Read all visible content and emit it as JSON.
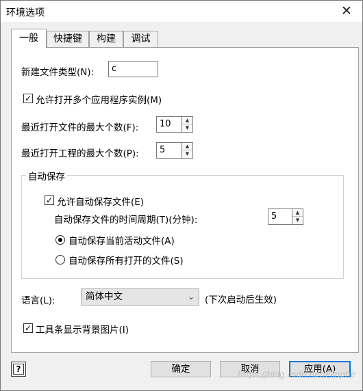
{
  "window": {
    "title": "环境选项",
    "close_glyph": "✕"
  },
  "tabs": [
    {
      "label": "一般",
      "active": true
    },
    {
      "label": "快捷键",
      "active": false
    },
    {
      "label": "构建",
      "active": false
    },
    {
      "label": "调试",
      "active": false
    }
  ],
  "general": {
    "new_file_type_label": "新建文件类型(N):",
    "new_file_type_value": "c",
    "allow_multi_instance_label": "允许打开多个应用程序实例(M)",
    "allow_multi_instance_checked": true,
    "recent_files_label": "最近打开文件的最大个数(F):",
    "recent_files_value": "10",
    "recent_projects_label": "最近打开工程的最大个数(P):",
    "recent_projects_value": "5"
  },
  "autosave": {
    "group_title": "自动保存",
    "enable_label": "允许自动保存文件(E)",
    "enable_checked": true,
    "period_label": "自动保存文件的时间周期(T)(分钟):",
    "period_value": "5",
    "option_current_label": "自动保存当前活动文件(A)",
    "option_all_label": "自动保存所有打开的文件(S)",
    "selected_option": "current"
  },
  "language": {
    "label": "语言(L):",
    "value": "简体中文",
    "hint": "(下次启动后生效)"
  },
  "toolbar_bg": {
    "label": "工具条显示背景图片(I)",
    "checked": true
  },
  "buttons": {
    "help": "?",
    "ok": "确定",
    "cancel": "取消",
    "apply": "应用(A)"
  },
  "watermark": "https://blog.csdn.net/Flinphe",
  "icons": {
    "check": "✓",
    "spin_up": "▲",
    "spin_down": "▼",
    "dropdown": "⌄"
  }
}
